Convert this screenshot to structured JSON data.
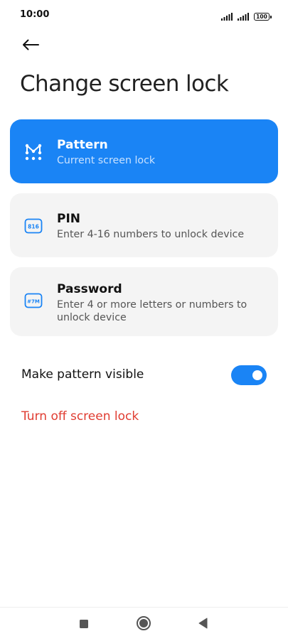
{
  "status_bar": {
    "time": "10:00",
    "battery": "100",
    "icons": [
      "signal-icon",
      "signal-icon",
      "battery-icon"
    ]
  },
  "header": {
    "back_icon": "arrow-left-icon",
    "title": "Change screen lock"
  },
  "options": [
    {
      "title": "Pattern",
      "description": "Current screen lock",
      "icon": "pattern-icon",
      "selected": true
    },
    {
      "title": "PIN",
      "description": "Enter 4-16 numbers to unlock device",
      "icon": "pin-icon",
      "icon_text": "816",
      "selected": false
    },
    {
      "title": "Password",
      "description": "Enter 4 or more letters or numbers to unlock device",
      "icon": "password-icon",
      "icon_text": "#7M",
      "selected": false
    }
  ],
  "settings": {
    "pattern_visible_label": "Make pattern visible",
    "pattern_visible": true,
    "turn_off_label": "Turn off screen lock"
  },
  "nav_bar": {
    "buttons": [
      "recents-square-icon",
      "home-circle-icon",
      "back-triangle-icon"
    ]
  },
  "colors": {
    "accent": "#1a84f5",
    "danger": "#e03c31",
    "card_background": "#f4f4f4"
  }
}
